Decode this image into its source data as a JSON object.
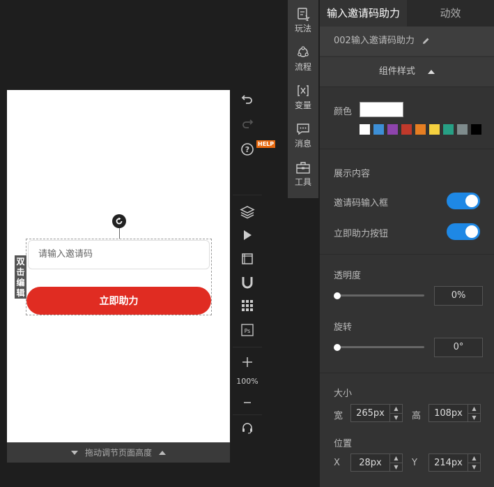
{
  "canvas": {
    "input_placeholder": "请输入邀请码",
    "button_label": "立即助力",
    "dblclick_tag": [
      "双",
      "击",
      "编",
      "辑"
    ],
    "page_height_label": "拖动调节页面高度",
    "zoom_level": "100%",
    "help_badge": "HELP"
  },
  "vertical_menu": {
    "items": [
      {
        "label": "玩法",
        "icon": "gameplay-icon"
      },
      {
        "label": "流程",
        "icon": "flow-icon"
      },
      {
        "label": "变量",
        "icon": "variable-icon"
      },
      {
        "label": "消息",
        "icon": "message-icon"
      },
      {
        "label": "工具",
        "icon": "toolbox-icon"
      }
    ]
  },
  "panel": {
    "tabs": [
      "输入邀请码助力",
      "动效"
    ],
    "component_name": "002输入邀请码助力",
    "style_header": "组件样式",
    "color_label": "颜色",
    "color_value": "#ffffff",
    "swatches": [
      "#ffffff",
      "#3d8fd6",
      "#8e44ad",
      "#c0392b",
      "#e67e22",
      "#f4d03f",
      "#27a085",
      "#7f8c8d",
      "#000000"
    ],
    "display_section": "展示内容",
    "toggle_input": "邀请码输入框",
    "toggle_button": "立即助力按钮",
    "opacity_label": "透明度",
    "opacity_value": "0%",
    "rotate_label": "旋转",
    "rotate_value": "0°",
    "size_label": "大小",
    "width_label": "宽",
    "width_value": "265px",
    "height_label": "高",
    "height_value": "108px",
    "position_label": "位置",
    "x_label": "X",
    "x_value": "28px",
    "y_label": "Y",
    "y_value": "214px"
  }
}
